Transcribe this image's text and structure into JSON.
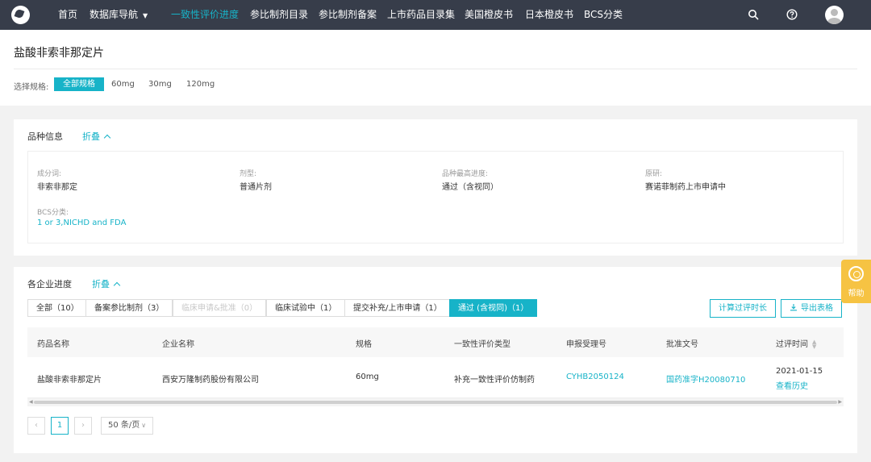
{
  "nav": {
    "items": [
      {
        "label": "首页"
      },
      {
        "label": "数据库导航"
      },
      {
        "label": "一致性评价进度"
      },
      {
        "label": "参比制剂目录"
      },
      {
        "label": "参比制剂备案"
      },
      {
        "label": "上市药品目录集"
      },
      {
        "label": "美国橙皮书"
      },
      {
        "label": "日本橙皮书"
      },
      {
        "label": "BCS分类"
      }
    ],
    "active_index": 2,
    "icons": [
      "search-icon",
      "help-circle-icon",
      "user-avatar-icon"
    ]
  },
  "header": {
    "title": "盐酸非索非那定片",
    "spec_label": "选择规格:",
    "spec_options": [
      "全部规格",
      "60mg",
      "30mg",
      "120mg"
    ],
    "spec_selected": "全部规格"
  },
  "variety": {
    "title": "品种信息",
    "fold_label": "折叠",
    "fields": [
      {
        "label": "成分词:",
        "value": "非索非那定"
      },
      {
        "label": "剂型:",
        "value": "普通片剂"
      },
      {
        "label": "品种最高进度:",
        "value": "通过（含视同）"
      },
      {
        "label": "原研:",
        "value": "赛诺菲制药上市申请中"
      },
      {
        "label": "BCS分类:",
        "value": "1 or 3,NICHD and FDA"
      }
    ]
  },
  "progress": {
    "title": "各企业进度",
    "fold_label": "折叠",
    "tabs": [
      {
        "label": "全部（10）"
      },
      {
        "label": "备案参比制剂（3）"
      },
      {
        "label": "临床申请&批准（0）"
      },
      {
        "label": "临床试验中（1）"
      },
      {
        "label": "提交补充/上市申请（1）"
      },
      {
        "label": "通过 (含视同)（1）"
      }
    ],
    "active_tab": 5,
    "buttons": {
      "calc": "计算过评时长",
      "export": "导出表格"
    },
    "columns": [
      "药品名称",
      "企业名称",
      "规格",
      "一致性评价类型",
      "申报受理号",
      "批准文号",
      "过评时间"
    ],
    "rows": [
      {
        "drug": "盐酸非索非那定片",
        "company": "西安万隆制药股份有限公司",
        "spec": "60mg",
        "type": "补充一致性评价仿制药",
        "accept_no": "CYHB2050124",
        "approval_no": "国药准字H20080710",
        "date": "2021-01-15",
        "history": "查看历史"
      }
    ],
    "pagination": {
      "current": "1",
      "page_size": "50 条/页"
    }
  },
  "help": {
    "label": "帮助"
  },
  "colors": {
    "accent": "#17b3c8",
    "nav_bg": "#373d4a",
    "help_bg": "#f6c343"
  }
}
